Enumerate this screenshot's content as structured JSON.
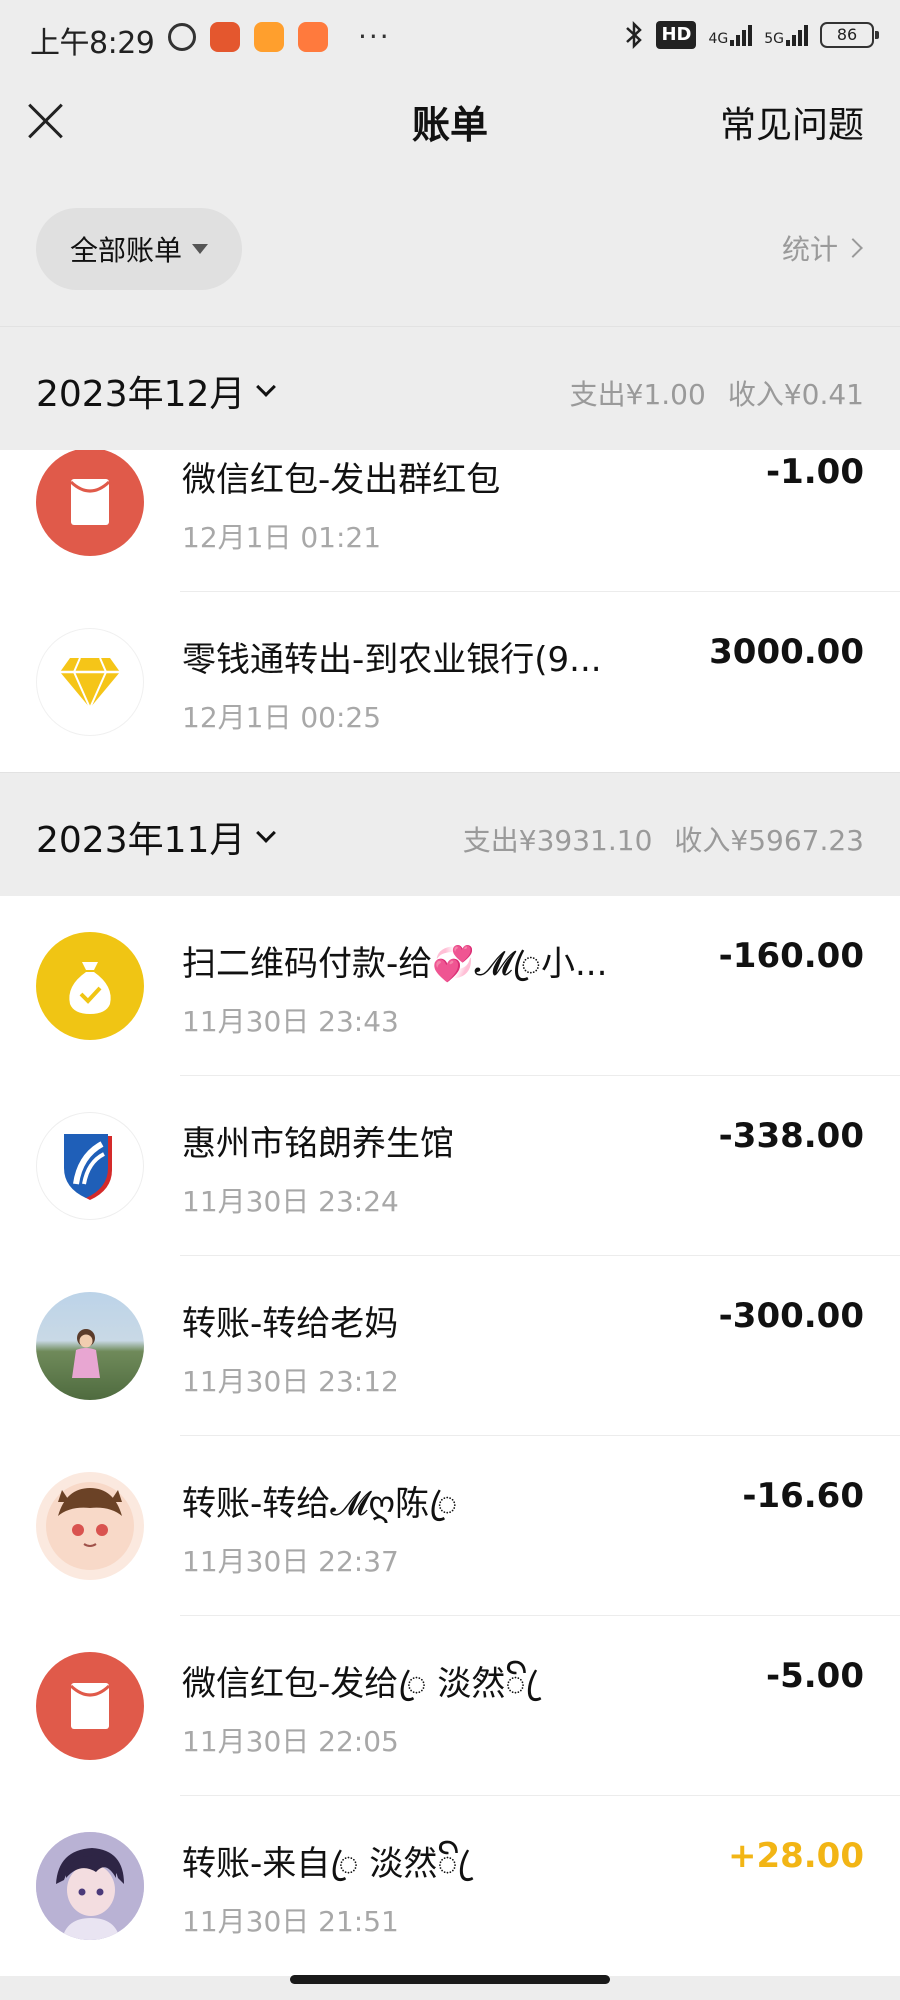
{
  "status_bar": {
    "time": "上午8:29",
    "network_4g": "4G",
    "network_5g": "5G",
    "hd_label": "HD",
    "battery": "86"
  },
  "nav": {
    "title": "账单",
    "faq": "常见问题"
  },
  "filter": {
    "label": "全部账单",
    "stats": "统计"
  },
  "months": [
    {
      "title": "2023年12月",
      "expense": "支出¥1.00",
      "income": "收入¥0.41",
      "items": [
        {
          "title": "微信红包-发出群红包",
          "time": "12月1日 01:21",
          "amount": "-1.00",
          "icon": "red-envelope-icon"
        },
        {
          "title": "零钱通转出-到农业银行(9...",
          "time": "12月1日 00:25",
          "amount": "3000.00",
          "icon": "diamond-icon"
        }
      ]
    },
    {
      "title": "2023年11月",
      "expense": "支出¥3931.10",
      "income": "收入¥5967.23",
      "items": [
        {
          "title": "扫二维码付款-给💞𝓜ꦿ小...",
          "time": "11月30日 23:43",
          "amount": "-160.00",
          "icon": "money-bag-icon"
        },
        {
          "title": "惠州市铭朗养生馆",
          "time": "11月30日 23:24",
          "amount": "-338.00",
          "icon": "merchant-logo"
        },
        {
          "title": "转账-转给老妈",
          "time": "11月30日 23:12",
          "amount": "-300.00",
          "icon": "child-photo-avatar"
        },
        {
          "title": "转账-转给𝓜ღ陈ꦿ",
          "time": "11月30日 22:37",
          "amount": "-16.60",
          "icon": "cartoon-girl-avatar"
        },
        {
          "title": "微信红包-发给ꦿ 淡然ꦼ ꦿ",
          "time": "11月30日 22:05",
          "amount": "-5.00",
          "icon": "red-envelope-icon"
        },
        {
          "title": "转账-来自ꦿ 淡然ꦼ ꦿ",
          "time": "11月30日 21:51",
          "amount": "+28.00",
          "icon": "anime-boy-avatar"
        }
      ]
    }
  ],
  "colors": {
    "background": "#ededed",
    "income": "#f2b515",
    "red_envelope": "#e05a4a",
    "money_bag": "#f0c514",
    "diamond": "#f5c518"
  }
}
